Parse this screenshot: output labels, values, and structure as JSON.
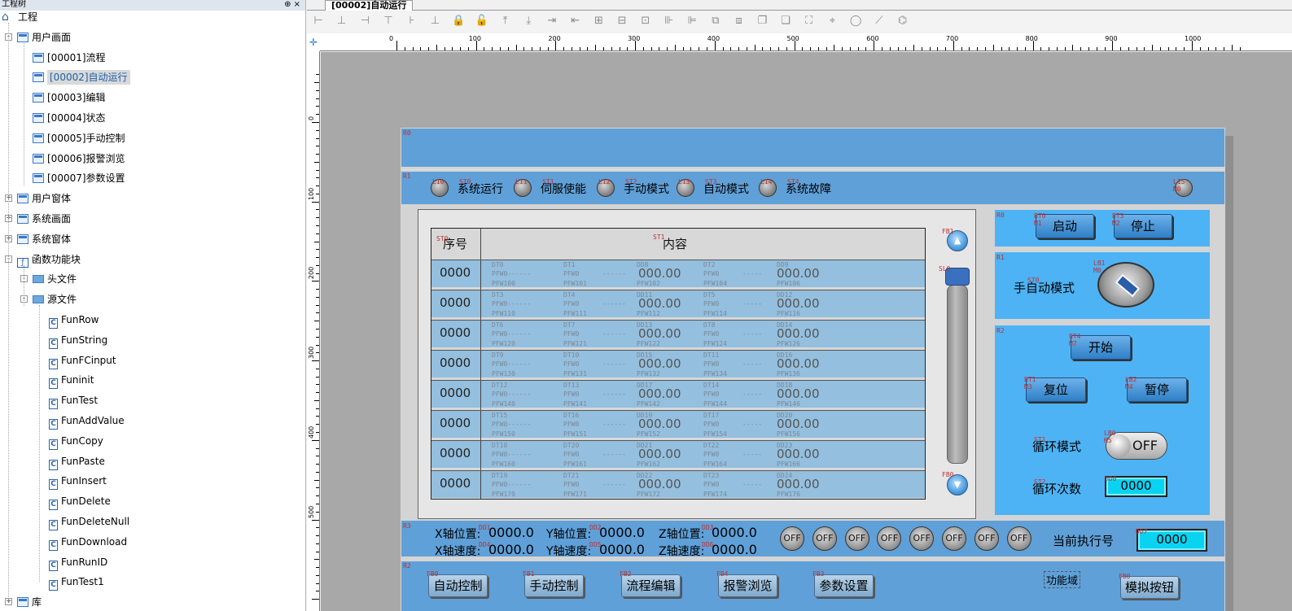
{
  "project_panel": {
    "title": "工程树",
    "pin_glyphs": "⊕ ×",
    "tree": [
      {
        "label": "工程",
        "level": 0
      },
      {
        "label": "用户画面",
        "level": 1
      },
      {
        "label": "[00001]流程",
        "level": 2
      },
      {
        "label": "[00002]自动运行",
        "level": 2,
        "selected": true
      },
      {
        "label": "[00003]编辑",
        "level": 2
      },
      {
        "label": "[00004]状态",
        "level": 2
      },
      {
        "label": "[00005]手动控制",
        "level": 2
      },
      {
        "label": "[00006]报警浏览",
        "level": 2
      },
      {
        "label": "[00007]参数设置",
        "level": 2
      },
      {
        "label": "用户窗体",
        "level": 1
      },
      {
        "label": "系统画面",
        "level": 1
      },
      {
        "label": "系统窗体",
        "level": 1
      },
      {
        "label": "函数功能块",
        "level": 1
      },
      {
        "label": "头文件",
        "level": 2
      },
      {
        "label": "源文件",
        "level": 2
      },
      {
        "label": "FunRow",
        "level": 3
      },
      {
        "label": "FunString",
        "level": 3
      },
      {
        "label": "FunFCinput",
        "level": 3
      },
      {
        "label": "Funinit",
        "level": 3
      },
      {
        "label": "FunTest",
        "level": 3
      },
      {
        "label": "FunAddValue",
        "level": 3
      },
      {
        "label": "FunCopy",
        "level": 3
      },
      {
        "label": "FunPaste",
        "level": 3
      },
      {
        "label": "FunInsert",
        "level": 3
      },
      {
        "label": "FunDelete",
        "level": 3
      },
      {
        "label": "FunDeleteNull",
        "level": 3
      },
      {
        "label": "FunDownload",
        "level": 3
      },
      {
        "label": "FunRunID",
        "level": 3
      },
      {
        "label": "FunTest1",
        "level": 3
      },
      {
        "label": "库",
        "level": 1
      }
    ]
  },
  "editor": {
    "tab_label": "[00002]自动运行",
    "corner_icon": "✛",
    "toolbar_icons": [
      "align-left",
      "align-hcenter",
      "align-right",
      "align-top",
      "align-vcenter",
      "align-bottom",
      "lock",
      "unlock",
      "bring-top",
      "send-bottom",
      "move-right",
      "move-left",
      "same-width",
      "same-height",
      "same-size",
      "h-space",
      "v-space",
      "group",
      "ungroup",
      "bring-front",
      "send-back",
      "fit",
      "snap",
      "circle",
      "link",
      "node"
    ],
    "ruler_h_labels": [
      "0",
      "100",
      "200",
      "300",
      "400",
      "500",
      "600",
      "700",
      "800",
      "900",
      "1000"
    ],
    "ruler_v_labels": [
      "0",
      "100",
      "200",
      "300",
      "400",
      "500"
    ]
  },
  "screen": {
    "region_tags": {
      "r0_top": "R0",
      "r1_status": "R1",
      "r0_table": "R0",
      "r3_axis": "R3",
      "r2_nav": "R2",
      "r0_right": "R0",
      "r1_right": "R1",
      "r2_right": "R2"
    },
    "status_leds": [
      {
        "tag": "L10",
        "stag": "ST0",
        "label": "系统运行"
      },
      {
        "tag": "L11",
        "stag": "ST1",
        "label": "伺服使能"
      },
      {
        "tag": "L12",
        "stag": "ST2",
        "label": "手动模式"
      },
      {
        "tag": "L13",
        "stag": "ST3",
        "label": "自动模式"
      },
      {
        "tag": "L14",
        "stag": "ST4",
        "label": "系统故障"
      }
    ],
    "corner_led_tag": "L15 M0",
    "table": {
      "tag_top": "T0",
      "col_seq_tag": "ST0",
      "col_seq": "序号",
      "col_content_tag": "ST1",
      "col_content": "内容",
      "rows": [
        {
          "seq": "0000",
          "tags": [
            "DT0",
            "DT1",
            "DD8",
            "DT2",
            "DD9"
          ],
          "pfw": [
            "PFW0------",
            "PFW0",
            "------",
            "PFW0",
            "-----"
          ],
          "big": [
            "000.00",
            "000.00"
          ],
          "pfx": [
            "PFW100",
            "PFW101",
            "PFW102",
            "PFW104",
            "PFW106"
          ]
        },
        {
          "seq": "0000",
          "tags": [
            "DT3",
            "DT4",
            "DD11",
            "DT5",
            "DD12"
          ],
          "pfw": [
            "PFW0------",
            "PFW0",
            "------",
            "PFW0",
            "-----"
          ],
          "big": [
            "000.00",
            "000.00"
          ],
          "pfx": [
            "PFW110",
            "PFW111",
            "PFW112",
            "PFW114",
            "PFW116"
          ]
        },
        {
          "seq": "0000",
          "tags": [
            "DT6",
            "DT7",
            "DD13",
            "DT8",
            "DD14"
          ],
          "pfw": [
            "PFW0------",
            "PFW0",
            "------",
            "PFW0",
            "-----"
          ],
          "big": [
            "000.00",
            "000.00"
          ],
          "pfx": [
            "PFW120",
            "PFW121",
            "PFW122",
            "PFW124",
            "PFW126"
          ]
        },
        {
          "seq": "0000",
          "tags": [
            "DT9",
            "DT10",
            "DD15",
            "DT11",
            "DD16"
          ],
          "pfw": [
            "PFW0------",
            "PFW0",
            "------",
            "PFW0",
            "-----"
          ],
          "big": [
            "000.00",
            "000.00"
          ],
          "pfx": [
            "PFW130",
            "PFW131",
            "PFW132",
            "PFW134",
            "PFW136"
          ]
        },
        {
          "seq": "0000",
          "tags": [
            "DT12",
            "DT13",
            "DD17",
            "DT14",
            "DD18"
          ],
          "pfw": [
            "PFW0------",
            "PFW0",
            "------",
            "PFW0",
            "-----"
          ],
          "big": [
            "000.00",
            "000.00"
          ],
          "pfx": [
            "PFW140",
            "PFW141",
            "PFW142",
            "PFW144",
            "PFW146"
          ]
        },
        {
          "seq": "0000",
          "tags": [
            "DT15",
            "DT16",
            "DD19",
            "DT17",
            "DD20"
          ],
          "pfw": [
            "PFW0------",
            "PFW0",
            "------",
            "PFW0",
            "-----"
          ],
          "big": [
            "000.00",
            "000.00"
          ],
          "pfx": [
            "PFW150",
            "PFW151",
            "PFW152",
            "PFW154",
            "PFW156"
          ]
        },
        {
          "seq": "0000",
          "tags": [
            "DT18",
            "DT20",
            "DD21",
            "DT22",
            "DD23"
          ],
          "pfw": [
            "PFW0------",
            "PFW0",
            "------",
            "PFW0",
            "-----"
          ],
          "big": [
            "000.00",
            "000.00"
          ],
          "pfx": [
            "PFW160",
            "PFW161",
            "PFW162",
            "PFW164",
            "PFW166"
          ]
        },
        {
          "seq": "0000",
          "tags": [
            "DT19",
            "DT21",
            "DD22",
            "DT23",
            "DD24"
          ],
          "pfw": [
            "PFW0------",
            "PFW0",
            "------",
            "PFW0",
            "-----"
          ],
          "big": [
            "000.00",
            "000.00"
          ],
          "pfx": [
            "PFW170",
            "PFW171",
            "PFW172",
            "PFW174",
            "PFW176"
          ]
        }
      ],
      "scroll_up_tag": "FB1",
      "scroll_down_tag": "FB0",
      "slider_tag": "SL0"
    },
    "right_panel": {
      "start_tag": "BT0 M1",
      "start": "启动",
      "stop_tag": "BT3 M2",
      "stop": "停止",
      "mode_tag": "ST0",
      "mode_label": "手自动模式",
      "knob_tag": "LB1 M0",
      "begin_tag": "BT4 M7",
      "begin": "开始",
      "reset_tag": "BT1 M3",
      "reset": "复位",
      "pause_tag": "LB2 M4",
      "pause": "暂停",
      "loop_tag": "ST1",
      "loop_mode": "循环模式",
      "toggle_tag": "LB0 M5",
      "toggle_state": "OFF",
      "count_tag": "ST2",
      "loop_count": "循环次数",
      "count_box_tag": "DD0",
      "loop_count_value": "0000"
    },
    "axis": {
      "x_pos_label": "X轴位置:",
      "x_pos": "0000.0",
      "x_spd_label": "X轴速度:",
      "x_spd": "0000.0",
      "y_pos_label": "Y轴位置:",
      "y_pos": "0000.0",
      "y_spd_label": "Y轴速度:",
      "y_spd": "0000.0",
      "z_pos_label": "Z轴位置:",
      "z_pos": "0000.0",
      "z_spd_label": "Z轴速度:",
      "z_spd": "0000.0",
      "tags": {
        "x1": "DD1",
        "x2": "DD4",
        "y1": "DD2",
        "y2": "DD5",
        "z1": "DD3",
        "z2": "DD6"
      },
      "off_leds": [
        "OFF",
        "OFF",
        "OFF",
        "OFF",
        "OFF",
        "OFF",
        "OFF",
        "OFF"
      ],
      "current_id_label": "当前执行号",
      "current_id_tag": "DD7",
      "current_id": "0000"
    },
    "nav": [
      {
        "tag": "FB0",
        "label": "自动控制"
      },
      {
        "tag": "FB1",
        "label": "手动控制"
      },
      {
        "tag": "FB2",
        "label": "流程编辑"
      },
      {
        "tag": "FB4",
        "label": "报警浏览"
      },
      {
        "tag": "FB3",
        "label": "参数设置"
      }
    ],
    "func_area": "功能域",
    "sim_tag": "FB0",
    "sim_button": "模拟按钮"
  },
  "colors": {
    "band": "#5fa0d8",
    "panel": "#4db3f5",
    "row": "#94bfde",
    "numbox": "#0ad3f2"
  }
}
